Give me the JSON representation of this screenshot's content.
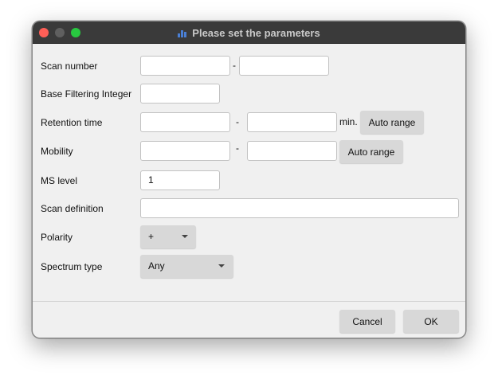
{
  "window": {
    "title": "Please set the parameters"
  },
  "fields": {
    "scan_number": {
      "label": "Scan number",
      "from": "",
      "to": "",
      "separator": "-"
    },
    "base_filtering": {
      "label": "Base Filtering Integer",
      "value": ""
    },
    "retention_time": {
      "label": "Retention time",
      "from": "",
      "to": "",
      "separator": "-",
      "unit": "min.",
      "auto_range_label": "Auto range"
    },
    "mobility": {
      "label": "Mobility",
      "from": "",
      "to": "",
      "separator": "-",
      "auto_range_label": "Auto range"
    },
    "ms_level": {
      "label": "MS level",
      "value": "1"
    },
    "scan_definition": {
      "label": "Scan definition",
      "value": ""
    },
    "polarity": {
      "label": "Polarity",
      "selected": "+"
    },
    "spectrum_type": {
      "label": "Spectrum type",
      "selected": "Any"
    }
  },
  "footer": {
    "cancel_label": "Cancel",
    "ok_label": "OK"
  },
  "colors": {
    "titlebar": "#3a3a3a",
    "close": "#ff5f57",
    "max": "#28c840",
    "button": "#d8d8d8"
  }
}
